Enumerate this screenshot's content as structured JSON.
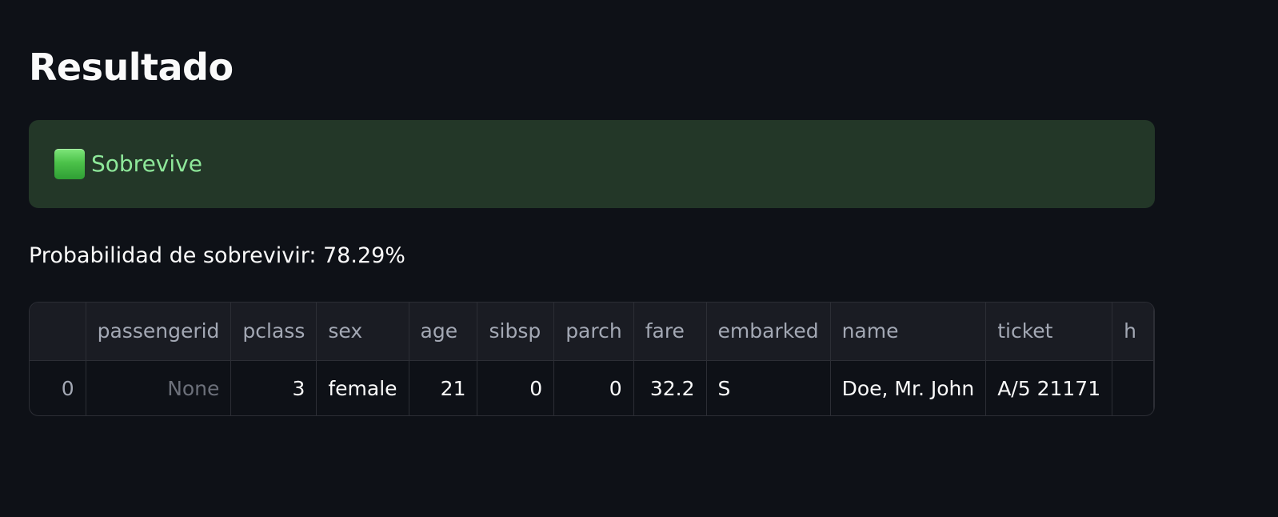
{
  "page": {
    "title": "Resultado"
  },
  "result_alert": {
    "icon": "green-square-icon",
    "label": "Sobrevive",
    "color": "#233728",
    "text_color": "#8ee89a"
  },
  "probability_text": "Probabilidad de sobrevivir: 78.29%",
  "table": {
    "columns": [
      "",
      "passengerid",
      "pclass",
      "sex",
      "age",
      "sibsp",
      "parch",
      "fare",
      "embarked",
      "name",
      "ticket",
      "h"
    ],
    "rows": [
      [
        "0",
        "None",
        "3",
        "female",
        "21",
        "0",
        "0",
        "32.2",
        "S",
        "Doe, Mr. John",
        "A/5 21171",
        ""
      ]
    ]
  }
}
